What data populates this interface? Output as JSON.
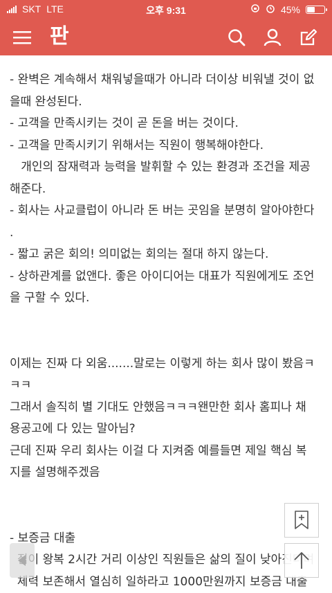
{
  "status_bar": {
    "carrier": "SKT",
    "network": "LTE",
    "time": "오후 9:31",
    "battery": "45%",
    "battery_level": 0.45
  },
  "header": {
    "logo_text": "판",
    "accent_color": "#e05a50"
  },
  "article": {
    "lines": [
      "- 완벽은 계속해서 채워넣을때가 아니라 더이상 비워낼 것이 없",
      "을때 완성된다.",
      "- 고객을 만족시키는 것이 곧 돈을 버는 것이다.",
      "- 고객을 만족시키기 위해서는 직원이 행복해야한다.",
      "   개인의 잠재력과 능력을 발휘할 수 있는 환경과 조건을 제공",
      "해준다.",
      "- 회사는 사교클럽이 아니라 돈 버는 곳임을 분명히 알아야한다",
      ".",
      "- 짧고 굵은 회의! 의미없는 회의는 절대 하지 않는다.",
      "- 상하관계를 없앤다. 좋은 아이디어는 대표가 직원에게도 조언",
      "을 구할 수 있다.",
      "",
      "",
      "이제는 진짜 다 외움.......말로는 이렇게 하는 회사 많이 봤음ㅋ",
      "ㅋㅋ",
      "그래서 솔직히 별 기대도 안했음ㅋㅋㅋ왠만한 회사 홈피나 채",
      "용공고에 다 있는 말아님?",
      "근데 진짜 우리 회사는 이걸 다 지켜줌 예를들면 제일 핵심 복",
      "지를 설명해주겠음",
      "",
      "",
      "- 보증금 대출",
      "  집이 왕복 2시간 거리 이상인 직원들은 삶의 질이 낮아진다며",
      "  체력 보존해서 열심히 일하라고 1000만원까지 보증금 대출"
    ]
  }
}
